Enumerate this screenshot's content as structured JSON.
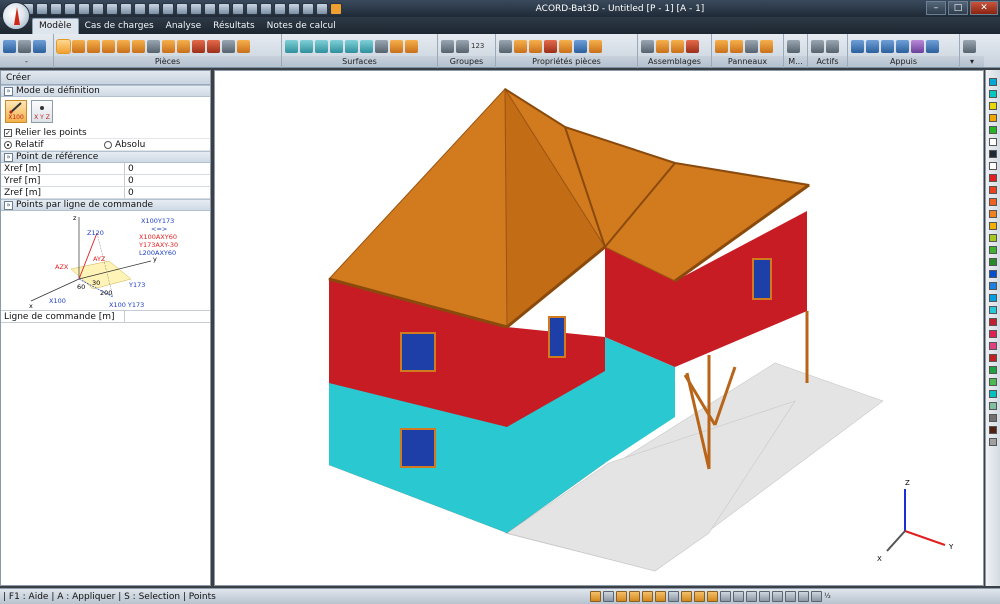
{
  "app": {
    "title": "ACORD-Bat3D - Untitled [P - 1] [A - 1]"
  },
  "window_controls": {
    "minimize": "–",
    "maximize": "□",
    "close": "✕"
  },
  "tabs": [
    "Modèle",
    "Cas de charges",
    "Analyse",
    "Résultats",
    "Notes de calcul"
  ],
  "ribbon": {
    "groups": [
      {
        "label": "-",
        "icon_count": 3
      },
      {
        "label": "Pièces",
        "icon_count": 15
      },
      {
        "label": "Surfaces",
        "icon_count": 9
      },
      {
        "label": "Groupes",
        "icon_count": 2,
        "text": "123"
      },
      {
        "label": "Propriétés pièces",
        "icon_count": 7
      },
      {
        "label": "Assemblages",
        "icon_count": 4
      },
      {
        "label": "Panneaux",
        "icon_count": 4
      },
      {
        "label": "M...",
        "icon_count": 1
      },
      {
        "label": "Actifs",
        "icon_count": 2
      },
      {
        "label": "Appuis",
        "icon_count": 6
      }
    ]
  },
  "left_panel": {
    "header": "Créer",
    "mode_section": "Mode de définition",
    "mode_buttons": [
      "X100",
      "X Y Z"
    ],
    "relier_points": "Relier les points",
    "relatif": "Relatif",
    "absolu": "Absolu",
    "ref_section": "Point de référence",
    "ref_fields": [
      {
        "label": "Xref  [m]",
        "value": "0"
      },
      {
        "label": "Yref  [m]",
        "value": "0"
      },
      {
        "label": "Zref  [m]",
        "value": "0"
      }
    ],
    "points_section": "Points par ligne de commande",
    "diagram": {
      "z_axis": "z",
      "y_axis": "y",
      "x_axis": "x",
      "z120": "Z120",
      "azx": "AZX",
      "ayz": "AYZ",
      "angle_60": "60",
      "angle_30": "30",
      "len_200": "200",
      "x100": "X100",
      "y173": "Y173",
      "x100y173": "X100 Y173",
      "cmd1": "X100Y173",
      "cmd2": "<=>",
      "cmd3": "X100AXY60",
      "cmd4": "Y173AXY-30",
      "cmd5": "L200AXY60"
    },
    "command_line": {
      "label": "Ligne de commande  [m]",
      "value": ""
    }
  },
  "view_axes": {
    "z": "Z",
    "x": "X",
    "y": "Y"
  },
  "status": {
    "text": "| F1 : Aide | A : Appliquer | S : Selection |  Points",
    "fraction": "½"
  },
  "palette": [
    "#00a9d8",
    "#00c8c0",
    "#e8d800",
    "#f0a800",
    "#28b428",
    "#ffffff",
    "#1e2a36",
    "#ffffff",
    "#e02020",
    "#e84020",
    "#f06020",
    "#f08020",
    "#f0b000",
    "#a8c820",
    "#40b030",
    "#2a8a2a",
    "#0050d0",
    "#2080e0",
    "#00a0e0",
    "#28c8d8",
    "#c02030",
    "#e02050",
    "#e04080",
    "#c02020",
    "#20a040",
    "#50b850",
    "#00c0c0",
    "#80c0a0",
    "#707070",
    "#502010",
    "#a0a0a0"
  ]
}
